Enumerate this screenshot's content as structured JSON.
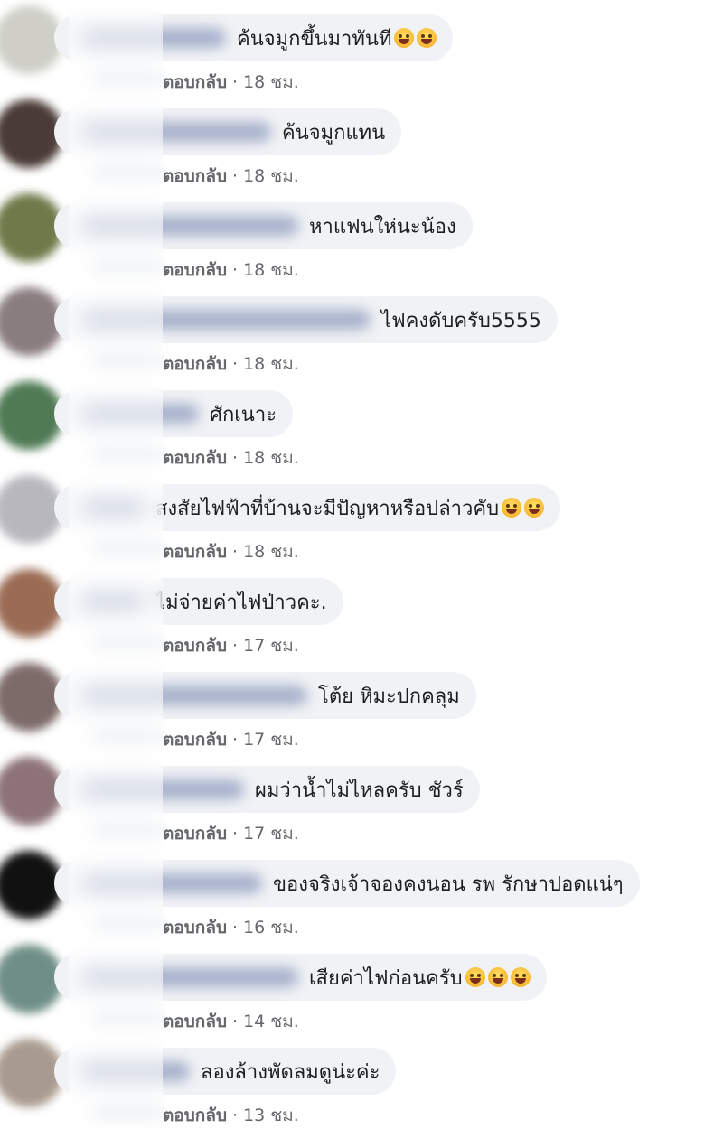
{
  "comments": [
    {
      "text": "ค้นจมูกขึ้นมาทันที",
      "emojis": [
        "laughing-tears-emoji",
        "laughing-tears-emoji"
      ],
      "reply": "ตอบกลับ",
      "time": "18 ชม.",
      "avatar_color": "#cfcfc8"
    },
    {
      "text": "ค้นจมูกแทน",
      "emojis": [],
      "reply": "ตอบกลับ",
      "time": "18 ชม.",
      "avatar_color": "#4a3b36"
    },
    {
      "text": "หาแฟนให่นะน้อง",
      "emojis": [],
      "reply": "ตอบกลับ",
      "time": "18 ชม.",
      "avatar_color": "#6f7a4a"
    },
    {
      "text": "ไฟคงดับครับ5555",
      "emojis": [],
      "reply": "ตอบกลับ",
      "time": "18 ชม.",
      "avatar_color": "#8a7d80"
    },
    {
      "text": "ศักเนาะ",
      "emojis": [],
      "reply": "ตอบกลับ",
      "time": "18 ชม.",
      "avatar_color": "#4f7a54"
    },
    {
      "text": "สงสัยไฟฟ้าที่บ้านจะมีปัญหาหรือปล่าวคับ",
      "emojis": [
        "grinning-squint-emoji",
        "grinning-squint-emoji"
      ],
      "reply": "ตอบกลับ",
      "time": "18 ชม.",
      "avatar_color": "#b7b7bd"
    },
    {
      "text": "ไม่จ่ายค่าไฟป่าวคะ.",
      "emojis": [],
      "reply": "ตอบกลับ",
      "time": "17 ชม.",
      "avatar_color": "#9b6b54"
    },
    {
      "text": "โต้ย หิมะปกคลุม",
      "emojis": [],
      "reply": "ตอบกลับ",
      "time": "17 ชม.",
      "avatar_color": "#7d6b6a"
    },
    {
      "text": "ผมว่าน้ำไม่ไหลครับ ชัวร์",
      "emojis": [],
      "reply": "ตอบกลับ",
      "time": "17 ชม.",
      "avatar_color": "#8d7378"
    },
    {
      "text": "ของจริงเจ้าจองคงนอน รพ รักษาปอดแน่ๆ",
      "emojis": [],
      "reply": "ตอบกลับ",
      "time": "16 ชม.",
      "avatar_color": "#111111"
    },
    {
      "text": "เสียค่าไฟก่อนครับ",
      "emojis": [
        "grinning-tongue-emoji",
        "grinning-tongue-emoji",
        "grinning-tongue-emoji"
      ],
      "reply": "ตอบกลับ",
      "time": "14 ชม.",
      "avatar_color": "#6f8f86"
    },
    {
      "text": "ลองล้างพัดลมดูน่ะค่ะ",
      "emojis": [],
      "reply": "ตอบกลับ",
      "time": "13 ชม.",
      "avatar_color": "#a89a8e"
    }
  ]
}
